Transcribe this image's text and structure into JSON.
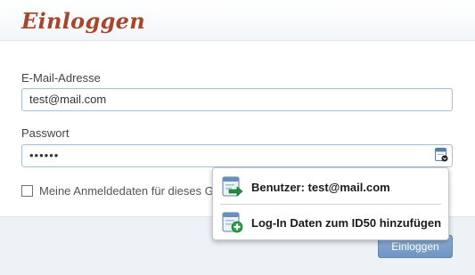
{
  "header": {
    "title": "Einloggen"
  },
  "form": {
    "email_label": "E-Mail-Adresse",
    "email_value": "test@mail.com",
    "password_label": "Passwort",
    "password_value": "••••••",
    "remember_label": "Meine Anmeldedaten für dieses G",
    "remember_checked": false,
    "password_field_icon": "password-manager-icon"
  },
  "footer": {
    "login_label": "Einloggen"
  },
  "popup": {
    "items": [
      {
        "label": "Benutzer: test@mail.com",
        "icon": "fill-login-icon"
      },
      {
        "label": "Log-In Daten zum ID50 hinzufügen",
        "icon": "add-login-icon"
      }
    ]
  },
  "colors": {
    "title": "#a8462c",
    "input_border": "#a9c0d9",
    "button": "#7b9ecb",
    "footer_bg": "#edf2f7",
    "arrow_green": "#1f8f3a"
  }
}
